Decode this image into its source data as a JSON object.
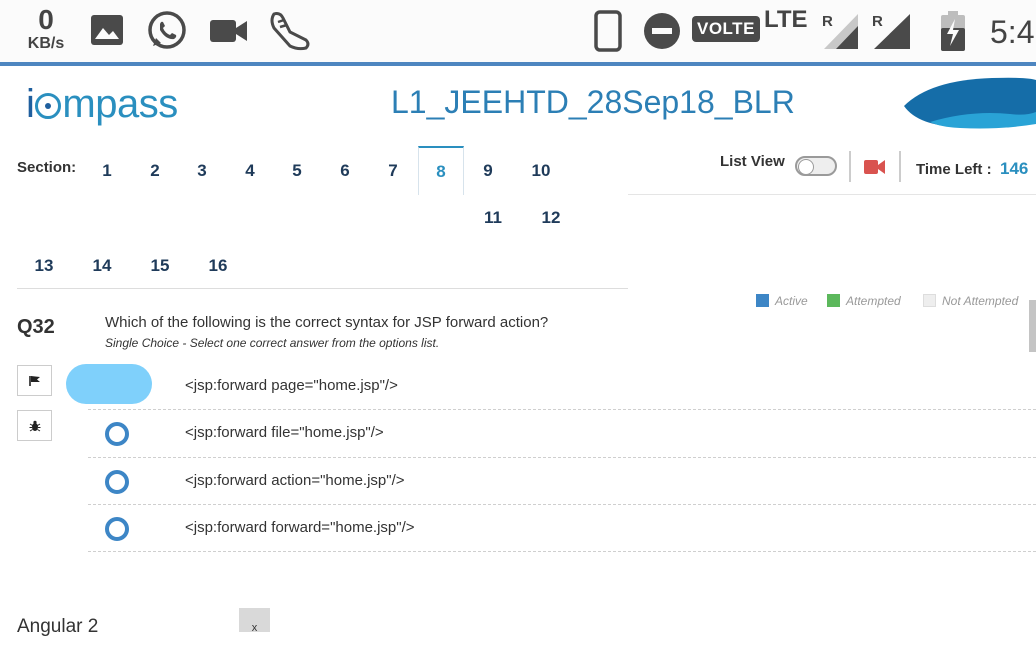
{
  "status_bar": {
    "net_speed_value": "0",
    "net_speed_unit": "KB/s",
    "volte": "VOLTE",
    "lte": "LTE",
    "roaming_1": "R",
    "roaming_2": "R",
    "clock": "5:4"
  },
  "header": {
    "logo_i": "i",
    "logo_c": "c",
    "logo_rest": "mpass",
    "title": "L1_JEEHTD_28Sep18_BLR"
  },
  "sections": {
    "label": "Section:",
    "items": [
      "1",
      "2",
      "3",
      "4",
      "5",
      "6",
      "7",
      "8",
      "9",
      "10",
      "11",
      "12",
      "13",
      "14",
      "15",
      "16"
    ],
    "active": "8"
  },
  "controls": {
    "list_view_label": "List View",
    "list_view_on": false,
    "time_left_label": "Time Left :",
    "time_left_value": "146"
  },
  "legend": [
    {
      "label": "Active",
      "color": "#3d86c6"
    },
    {
      "label": "Attempted",
      "color": "#5cb85c"
    },
    {
      "label": "Not Attempted",
      "color": "#eeeeee"
    }
  ],
  "question": {
    "number": "Q32",
    "text": "Which of the following is the correct syntax for JSP forward action?",
    "hint": "Single Choice - Select one correct answer from the options list.",
    "options": [
      "<jsp:forward page=\"home.jsp\"/>",
      "<jsp:forward file=\"home.jsp\"/>",
      "<jsp:forward action=\"home.jsp\"/>",
      "<jsp:forward forward=\"home.jsp\"/>"
    ],
    "selected_index": 0
  },
  "bottom": {
    "partial_text": "Angular 2",
    "close_label": "x"
  },
  "colors": {
    "accent": "#2a8fbf",
    "radio": "#3d86c6",
    "selected_highlight": "#7fd0fb",
    "camera": "#d9534f"
  }
}
